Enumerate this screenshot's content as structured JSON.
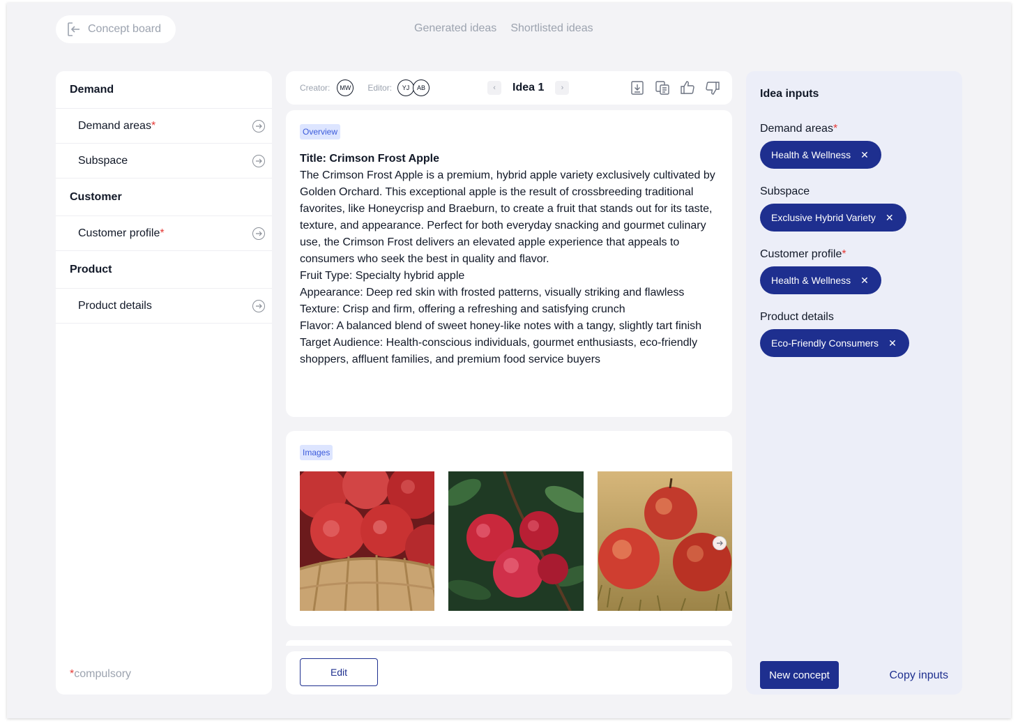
{
  "header": {
    "back_label": "Concept board",
    "tabs": [
      "Generated ideas",
      "Shortlisted ideas"
    ]
  },
  "left_panel": {
    "sections": [
      {
        "title": "Demand",
        "items": [
          {
            "label": "Demand areas",
            "required": "*"
          },
          {
            "label": "Subspace",
            "required": ""
          }
        ]
      },
      {
        "title": "Customer",
        "items": [
          {
            "label": "Customer profile",
            "required": "*"
          }
        ]
      },
      {
        "title": "Product",
        "items": [
          {
            "label": "Product details",
            "required": ""
          }
        ]
      }
    ],
    "footnote_star": "*",
    "footnote": "compulsory"
  },
  "toolbar": {
    "creator_label": "Creator:",
    "creator": "MW",
    "editor_label": "Editor:",
    "editors": [
      "YJ",
      "AB"
    ],
    "prev": "‹",
    "next": "›",
    "idea_title": "Idea 1",
    "icons": [
      "download-icon",
      "copy-icon",
      "thumbs-up-icon",
      "thumbs-down-icon"
    ]
  },
  "overview": {
    "tag": "Overview",
    "title": "Title: Crimson Frost Apple",
    "paragraph": "The Crimson Frost Apple is a premium, hybrid apple variety exclusively cultivated by Golden Orchard. This exceptional apple is the result of crossbreeding traditional favorites, like Honeycrisp and Braeburn, to create a fruit that stands out for its taste, texture, and appearance. Perfect for both everyday snacking and gourmet culinary use, the Crimson Frost delivers an elevated apple experience that appeals to consumers who seek the best in quality and flavor.",
    "fruit_type": "Fruit Type: Specialty hybrid apple",
    "appearance": "Appearance: Deep red skin with frosted patterns, visually striking and flawless",
    "texture": "Texture: Crisp and firm, offering a refreshing and satisfying crunch",
    "flavor": "Flavor: A balanced blend of sweet honey-like notes with a tangy, slightly tart finish",
    "audience": "Target Audience: Health-conscious individuals, gourmet enthusiasts, eco-friendly shoppers, affluent families, and premium food service buyers"
  },
  "images": {
    "tag": "Images",
    "items": [
      "apples-in-basket",
      "apples-on-branch",
      "apples-on-grass"
    ]
  },
  "actions": {
    "edit": "Edit"
  },
  "right_panel": {
    "title": "Idea inputs",
    "groups": [
      {
        "label": "Demand areas",
        "required": "*",
        "chip": "Health & Wellness"
      },
      {
        "label": "Subspace",
        "required": "",
        "chip": "Exclusive Hybrid Variety"
      },
      {
        "label": "Customer profile",
        "required": "*",
        "chip": "Health & Wellness"
      },
      {
        "label": "Product details",
        "required": "",
        "chip": "Eco-Friendly Consumers"
      }
    ],
    "chip_remove": "✕",
    "new_concept": "New concept",
    "copy_inputs": "Copy inputs"
  },
  "colors": {
    "accent": "#1e2f8f",
    "tag_bg": "#dde5ff",
    "required": "#e53935",
    "background": "#f3f3f6"
  }
}
